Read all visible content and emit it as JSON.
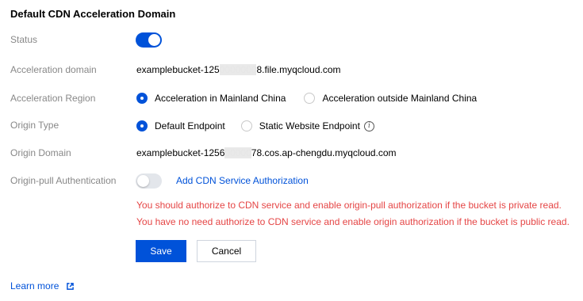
{
  "section": {
    "title": "Default CDN Acceleration Domain"
  },
  "status": {
    "label": "Status",
    "enabled": true
  },
  "acceleration_domain": {
    "label": "Acceleration domain",
    "value_prefix": "examplebucket-125",
    "value_masked": "0000000",
    "value_suffix": "8.file.myqcloud.com"
  },
  "acceleration_region": {
    "label": "Acceleration Region",
    "options": [
      "Acceleration in Mainland China",
      "Acceleration outside Mainland China"
    ],
    "selected": "Acceleration in Mainland China"
  },
  "origin_type": {
    "label": "Origin Type",
    "options": [
      "Default Endpoint",
      "Static Website Endpoint"
    ],
    "selected": "Default Endpoint",
    "info_icon": "info-icon"
  },
  "origin_domain": {
    "label": "Origin Domain",
    "value_prefix": "examplebucket-1256",
    "value_masked": "00000",
    "value_suffix": "78.cos.ap-chengdu.myqcloud.com"
  },
  "origin_pull_auth": {
    "label": "Origin-pull Authentication",
    "enabled": false,
    "link": "Add CDN Service Authorization",
    "messages": [
      "You should authorize to CDN service and enable origin-pull authorization if the bucket is private read.",
      "You have no need authorize to CDN service and enable origin authorization if the bucket is public read."
    ]
  },
  "buttons": {
    "save": "Save",
    "cancel": "Cancel"
  },
  "footer": {
    "learn_more": "Learn more",
    "icon": "external-link-icon"
  },
  "colors": {
    "primary": "#0052d9",
    "error": "#e54545",
    "label": "#888888"
  }
}
